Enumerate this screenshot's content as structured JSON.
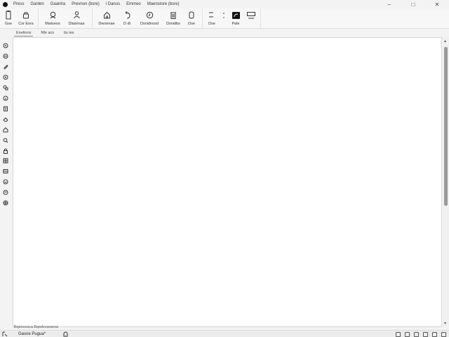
{
  "menu": {
    "items": [
      "Press",
      "Ganlen",
      "Gaanlra",
      "Prevnon (bsre)",
      "i  Danus",
      "Emmeo",
      "Maenstore (bsre)"
    ]
  },
  "window": {
    "minimize": "–",
    "maximize": "□",
    "close": "✕"
  },
  "ribbon": {
    "buttons": [
      {
        "label": "Gse",
        "icon": "clipboard-icon"
      },
      {
        "label": "Csr Esra",
        "icon": "cut-icon"
      },
      {
        "label": "Mwiseos",
        "icon": "user-icon"
      },
      {
        "label": "Dlasenas",
        "icon": "person-icon"
      },
      {
        "label": "Dwoenae",
        "icon": "house-icon"
      },
      {
        "label": "D dt",
        "icon": "undo-icon"
      },
      {
        "label": "Dsnidnosd",
        "icon": "clock-icon"
      },
      {
        "label": "Dsnidbs",
        "icon": "trash-icon"
      },
      {
        "label": "Dse",
        "icon": "circle-icon"
      }
    ],
    "tools": [
      {
        "label": "Dse",
        "icon": "line-icon"
      },
      {
        "label": "Pale",
        "icon": "fill-icon"
      },
      {
        "label": "",
        "icon": "rectangle-icon"
      }
    ]
  },
  "tabs": [
    "Eneltons",
    "Nfe acs",
    "bs ies"
  ],
  "caption": "Bqsncesca Bqsdvcsearsa",
  "status": {
    "text": "Gasne Pugua*"
  },
  "colors": {
    "accent": "#111111",
    "canvas": "#ffffff",
    "chrome": "#f3f3f3"
  },
  "left_tools": [
    "lasso-icon",
    "scissors-icon",
    "pen-icon",
    "eye-icon",
    "shapes-icon",
    "info-icon",
    "document-icon",
    "eraser-icon",
    "home-icon",
    "search-icon",
    "lock-icon",
    "grid-icon",
    "layers-icon",
    "heart-icon",
    "shield-icon",
    "globe-icon"
  ]
}
